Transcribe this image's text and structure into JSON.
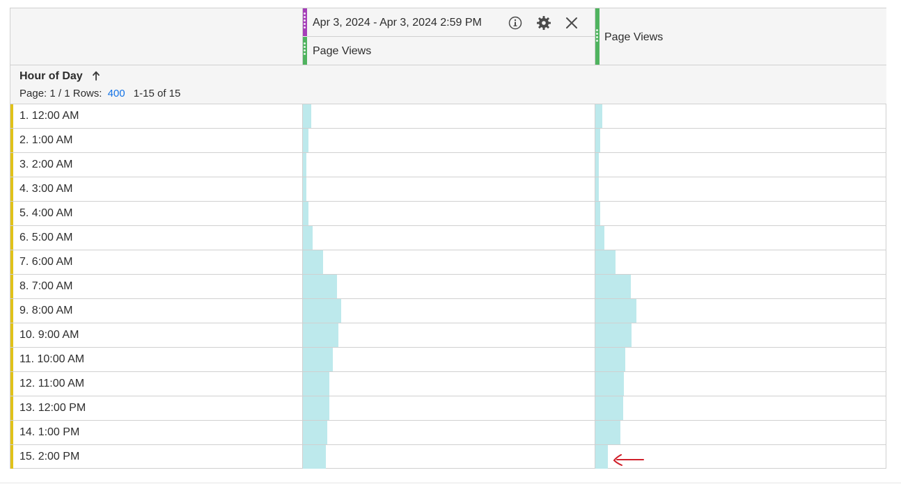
{
  "columns": {
    "segment_column": {
      "date_range": "Apr 3, 2024 - Apr 3, 2024 2:59 PM",
      "metric": "Page Views",
      "segment_color": "#a53fb8",
      "metric_color": "#4fb35f",
      "icons": [
        "info-icon",
        "gear-icon",
        "close-icon"
      ]
    },
    "second_column": {
      "metric": "Page Views",
      "metric_color": "#4fb35f"
    }
  },
  "dimension": {
    "title": "Hour of Day",
    "sort_icon": "arrow-up-icon",
    "page_label": "Page: 1 / 1",
    "rows_label": "Rows:",
    "rows_value": "400",
    "range_label": "1-15 of 15"
  },
  "colors": {
    "row_accent": "#e0c21a",
    "bar_fill": "#bde9ec",
    "link_blue": "#1473e6",
    "annotation_arrow": "#d0202a"
  },
  "rows": [
    {
      "label": "1.  12:00 AM",
      "bar1": 0.028,
      "bar2": 0.024
    },
    {
      "label": "2.  1:00 AM",
      "bar1": 0.018,
      "bar2": 0.016
    },
    {
      "label": "3.  2:00 AM",
      "bar1": 0.013,
      "bar2": 0.011
    },
    {
      "label": "4.  3:00 AM",
      "bar1": 0.013,
      "bar2": 0.011
    },
    {
      "label": "5.  4:00 AM",
      "bar1": 0.018,
      "bar2": 0.016
    },
    {
      "label": "6.  5:00 AM",
      "bar1": 0.033,
      "bar2": 0.031
    },
    {
      "label": "7.  6:00 AM",
      "bar1": 0.07,
      "bar2": 0.07
    },
    {
      "label": "8.  7:00 AM",
      "bar1": 0.117,
      "bar2": 0.122
    },
    {
      "label": "9.  8:00 AM",
      "bar1": 0.131,
      "bar2": 0.141
    },
    {
      "label": "10.  9:00 AM",
      "bar1": 0.122,
      "bar2": 0.124
    },
    {
      "label": "11.  10:00 AM",
      "bar1": 0.103,
      "bar2": 0.103
    },
    {
      "label": "12.  11:00 AM",
      "bar1": 0.091,
      "bar2": 0.098
    },
    {
      "label": "13.  12:00 PM",
      "bar1": 0.091,
      "bar2": 0.096
    },
    {
      "label": "14.  1:00 PM",
      "bar1": 0.084,
      "bar2": 0.086
    },
    {
      "label": "15.  2:00 PM",
      "bar1": 0.079,
      "bar2": 0.043
    }
  ]
}
